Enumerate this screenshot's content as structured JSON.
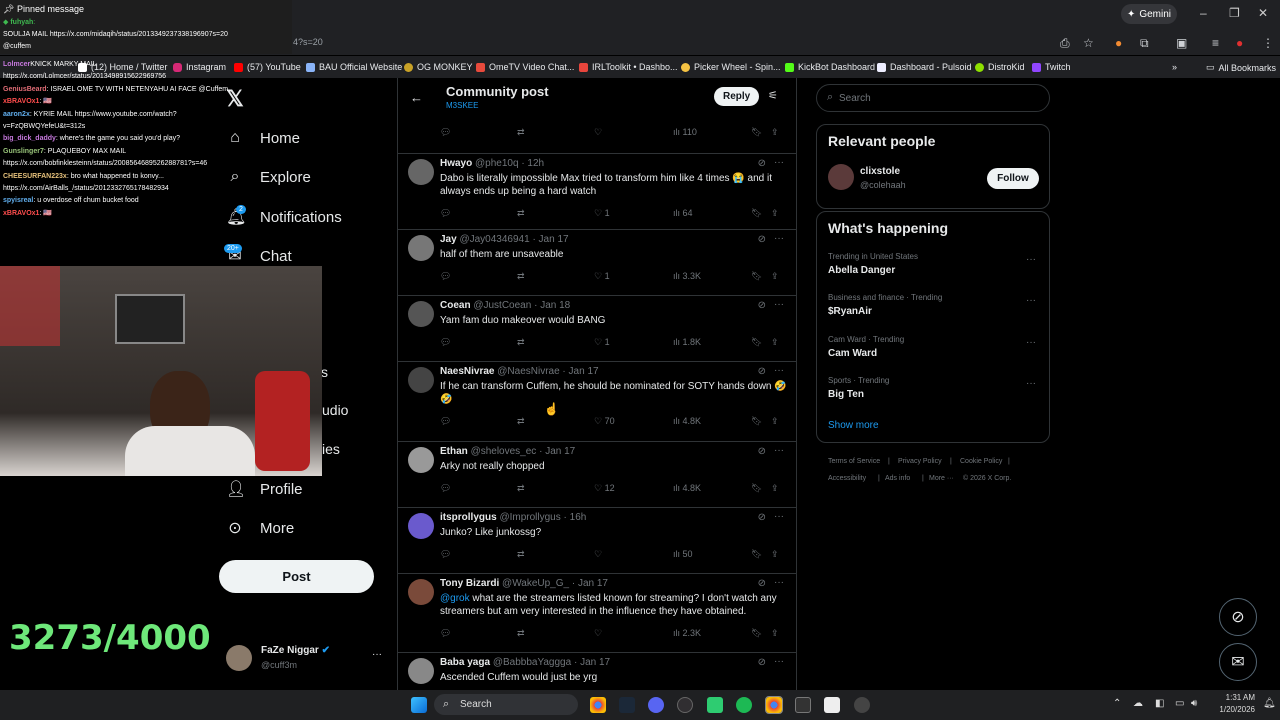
{
  "browser": {
    "address_fragment": "4?s=20",
    "gemini_label": "Gemini",
    "bookmarks": [
      {
        "label": "(12) Home / Twitter"
      },
      {
        "label": "Instagram"
      },
      {
        "label": "(57) YouTube"
      },
      {
        "label": "BAU Official Website"
      },
      {
        "label": "OG MONKEY"
      },
      {
        "label": "OmeTV Video Chat..."
      },
      {
        "label": "IRLToolkit • Dashbo..."
      },
      {
        "label": "Picker Wheel - Spin..."
      },
      {
        "label": "KickBot Dashboard"
      },
      {
        "label": "Dashboard - Pulsoid"
      },
      {
        "label": "DistroKid"
      },
      {
        "label": "Twitch"
      }
    ],
    "all_bookmarks": "All Bookmarks"
  },
  "stream_chat": {
    "pinned_label": "Pinned message",
    "pinned_user": "fuhyah",
    "pinned_text_1": "SOULJA MAIL https://x.com/midaqih/status/2013349237338196907s=20",
    "pinned_text_2": "@cuffem",
    "messages": [
      {
        "user": "Lolmcer",
        "text": "KNICK MARKY MAIL"
      },
      {
        "user": "",
        "text": "https://x.com/Lolmcer/status/2013498915622969756"
      },
      {
        "user": "GeniusBeard",
        "text": ": ISRAEL OME TV WITH NETENYAHU AI FACE @Cuffem"
      },
      {
        "user": "xBRAVOx1",
        "text": ": 🇺🇸"
      },
      {
        "user": "aaron2x",
        "text": ": KYRIE MAIL https://www.youtube.com/watch?"
      },
      {
        "user": "",
        "text": "v=FzQBWQYefeU&t=312s"
      },
      {
        "user": "big_dick_daddy",
        "text": ": where's the game you said you'd play?"
      },
      {
        "user": "Gunslinger7",
        "text": ": PLAQUEBOY MAX MAIL"
      },
      {
        "user": "",
        "text": "https://x.com/bobfinklesteinn/status/2008564689526288781?s=46"
      },
      {
        "user": "CHEESURFAN223x",
        "text": ": bro what happened to konvy..."
      },
      {
        "user": "",
        "text": "https://x.com/AirBalls_/status/2012332765178482934"
      },
      {
        "user": "spyisreal",
        "text": ": u overdose off chum bucket food"
      },
      {
        "user": "xBRAVOx1",
        "text": ": 🇺🇸"
      }
    ],
    "counter": "3273/4000"
  },
  "nav": {
    "home": "Home",
    "explore": "Explore",
    "notifications": "Notifications",
    "notifications_badge": "2",
    "chat": "Chat",
    "chat_badge": "20+",
    "partial_1": "s",
    "partial_2": "udio",
    "partial_3": "ies",
    "profile": "Profile",
    "more": "More",
    "post": "Post",
    "account_name": "FaZe Niggar",
    "account_handle": "@cuff3m"
  },
  "feed": {
    "title": "Community post",
    "subtitle": "M3SKEE",
    "reply_label": "Reply",
    "top_actions": {
      "views": "110"
    },
    "posts": [
      {
        "name": "Hwayo",
        "meta": "@phe10q · 12h",
        "text": "Dabo is literally impossible Max tried to transform him like 4 times 😭 and it always ends up being a hard watch",
        "likes": "1",
        "views": "64"
      },
      {
        "name": "Jay",
        "meta": "@Jay04346941 · Jan 17",
        "text": "half of them are unsaveable",
        "likes": "1",
        "views": "3.3K"
      },
      {
        "name": "Coean",
        "meta": "@JustCoean · Jan 18",
        "text": "Yam fam duo makeover would BANG",
        "likes": "1",
        "views": "1.8K"
      },
      {
        "name": "NaesNivrae",
        "meta": "@NaesNivrae · Jan 17",
        "text": "If he can transform Cuffem, he should be nominated for SOTY hands down 🤣🤣",
        "likes": "70",
        "views": "4.8K"
      },
      {
        "name": "Ethan",
        "meta": "@sheloves_ec · Jan 17",
        "text": "Arky not really chopped",
        "likes": "12",
        "views": "4.8K"
      },
      {
        "name": "itsprollygus",
        "meta": "@Improllygus · 16h",
        "text": "Junko? Like junkossg?",
        "likes": "",
        "views": "50"
      },
      {
        "name": "Tony Bizardi",
        "meta": "@WakeUp_G_ · Jan 17",
        "mention": "@grok",
        "text": " what are the streamers listed known for streaming? I don't watch any streamers but am very interested in the influence they have obtained.",
        "likes": "",
        "views": "2.3K"
      },
      {
        "name": "Baba yaga",
        "meta": "@BabbbaYaggga · Jan 17",
        "text": "Ascended Cuffem would just be yrg",
        "likes": "",
        "views": ""
      }
    ]
  },
  "sidebar": {
    "search_placeholder": "Search",
    "relevant_title": "Relevant people",
    "person_name": "clixstole",
    "person_handle": "@colehaah",
    "follow_label": "Follow",
    "happening_title": "What's happening",
    "trends": [
      {
        "meta": "Trending in United States",
        "name": "Abella Danger"
      },
      {
        "meta": "Business and finance · Trending",
        "name": "$RyanAir"
      },
      {
        "meta": "Cam Ward · Trending",
        "name": "Cam Ward"
      },
      {
        "meta": "Sports · Trending",
        "name": "Big Ten"
      }
    ],
    "show_more": "Show more",
    "footer": [
      "Terms of Service",
      "|",
      "Privacy Policy",
      "|",
      "Cookie Policy",
      "|",
      "Accessibility",
      "|",
      "Ads info",
      "|",
      "More ···",
      "© 2026 X Corp."
    ]
  },
  "taskbar": {
    "search_label": "Search",
    "time": "1:31 AM",
    "date": "1/20/2026"
  },
  "colors": {
    "accent": "#1d9bf0",
    "counter": "#6ee87a",
    "background": "#000000"
  }
}
